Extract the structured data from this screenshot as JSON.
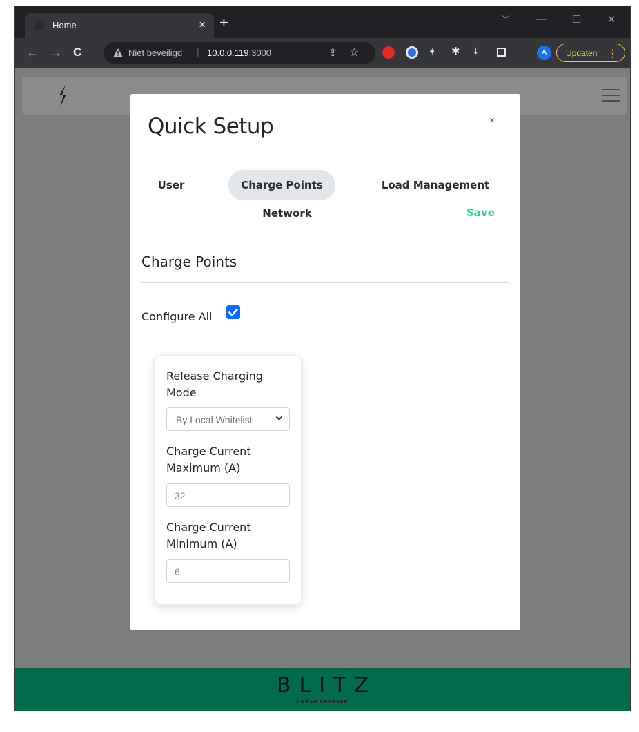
{
  "browser": {
    "tab_title": "Home",
    "tab_close": "×",
    "new_tab": "+",
    "window_controls": {
      "dropdown": "﹀",
      "minimize": "—",
      "maximize": "☐",
      "close": "✕"
    },
    "security_text": "Niet beveiligd",
    "url_host": "10.0.0.119",
    "url_port": ":3000",
    "profile_initial": "A",
    "update_label": "Updaten",
    "update_menu": "⋮",
    "extension_colors": {
      "adblock": "#d93025",
      "password": "#3b6bd6"
    }
  },
  "app": {
    "logo_icon": "bolt-icon",
    "menu_icon": "hamburger-icon"
  },
  "modal": {
    "title": "Quick Setup",
    "close": "×",
    "tabs": {
      "user": "User",
      "charge_points": "Charge Points",
      "load_management": "Load Management",
      "network": "Network"
    },
    "active_tab": "Charge Points",
    "save": "Save",
    "save_color": "#2fd39a",
    "section_title": "Charge Points",
    "configure_all_label": "Configure All",
    "configure_all_checked": true,
    "card": {
      "release_mode_label": "Release Charging Mode",
      "release_mode_value": "By Local Whitelist",
      "max_current_label": "Charge Current Maximum (A)",
      "max_current_value": "32",
      "min_current_label": "Charge Current Minimum (A)",
      "min_current_value": "6"
    }
  },
  "footer": {
    "brand": "BLITZ",
    "tagline": "POWER CHARGER",
    "color": "#036a4b"
  }
}
